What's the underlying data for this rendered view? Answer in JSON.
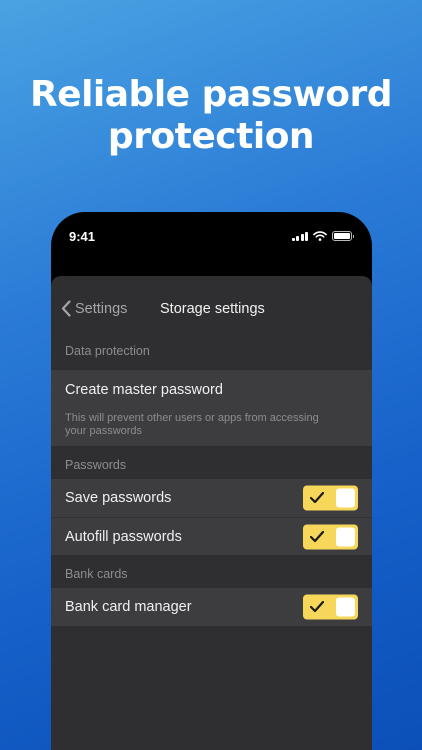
{
  "headline": {
    "line1": "Reliable password",
    "line2": "protection"
  },
  "status_bar": {
    "time": "9:41"
  },
  "nav": {
    "back_label": "Settings",
    "title": "Storage settings"
  },
  "sections": {
    "data_protection": {
      "header": "Data protection",
      "create_master": {
        "label": "Create master password",
        "description": "This will prevent other users or apps from accessing your passwords"
      }
    },
    "passwords": {
      "header": "Passwords",
      "save": {
        "label": "Save passwords",
        "enabled": true
      },
      "autofill": {
        "label": "Autofill passwords",
        "enabled": true
      }
    },
    "bank_cards": {
      "header": "Bank cards",
      "manager": {
        "label": "Bank card manager",
        "enabled": true
      }
    }
  },
  "colors": {
    "toggle_on": "#f7d75a",
    "sheet_bg": "#2f2f31",
    "row_bg": "#3d3d40",
    "bg_top": "#4aa3e2",
    "bg_bottom": "#0c4fb8"
  }
}
